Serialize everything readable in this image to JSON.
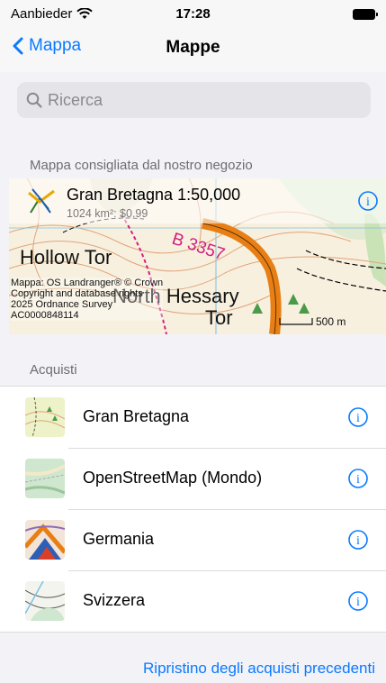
{
  "status_bar": {
    "carrier": "Aanbieder",
    "time": "17:28"
  },
  "nav": {
    "back_label": "Mappa",
    "title": "Mappe"
  },
  "search": {
    "placeholder": "Ricerca"
  },
  "featured_section": {
    "header": "Mappa consigliata dal nostro negozio",
    "title": "Gran Bretagna 1:50,000",
    "subtitle": "1024 km²: $0.99",
    "map_labels": {
      "road": "B 3357",
      "place_1": "Hollow Tor",
      "place_2": "North Hessary",
      "place_3": "Tor"
    },
    "copyright": "Mappa: OS Landranger® © Crown\nCopyright and database rights\n2025 Ordnance Survey\nAC0000848114",
    "scale": "500 m"
  },
  "purchases_section": {
    "header": "Acquisti",
    "items": [
      {
        "label": "Gran Bretagna"
      },
      {
        "label": "OpenStreetMap (Mondo)"
      },
      {
        "label": "Germania"
      },
      {
        "label": "Svizzera"
      }
    ]
  },
  "restore_label": "Ripristino degli acquisti precedenti",
  "colors": {
    "accent": "#0a7aff",
    "background": "#f2f2f7"
  }
}
